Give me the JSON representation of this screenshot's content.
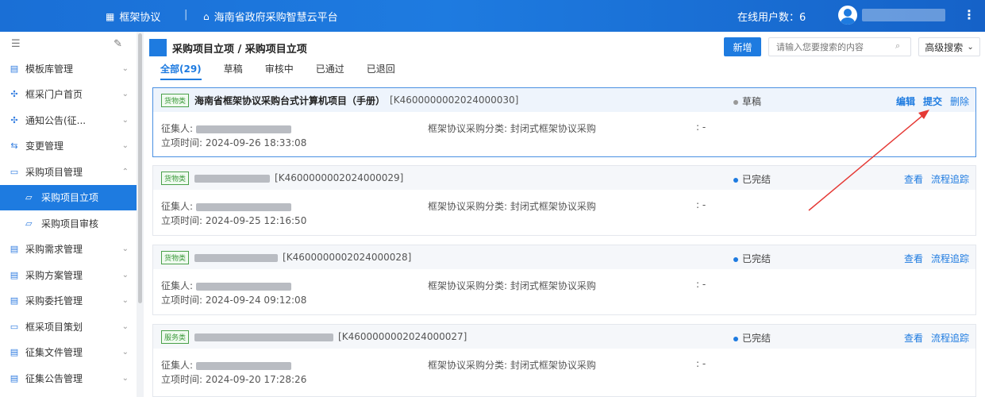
{
  "topbar": {
    "brand": "框架协议",
    "separator": "|",
    "platform": "海南省政府采购智慧云平台",
    "online_label": "在线用户数：",
    "online_count": "6"
  },
  "sidebar": {
    "items": [
      {
        "label": "模板库管理",
        "chevron": "⌄"
      },
      {
        "label": "框采门户首页",
        "chevron": "⌄"
      },
      {
        "label": "通知公告(征...",
        "chevron": "⌄"
      },
      {
        "label": "变更管理",
        "chevron": "⌄"
      },
      {
        "label": "采购项目管理",
        "chevron": "⌃"
      },
      {
        "label": "采购项目立项"
      },
      {
        "label": "采购项目审核"
      },
      {
        "label": "采购需求管理",
        "chevron": "⌄"
      },
      {
        "label": "采购方案管理",
        "chevron": "⌄"
      },
      {
        "label": "采购委托管理",
        "chevron": "⌄"
      },
      {
        "label": "框采项目策划",
        "chevron": "⌄"
      },
      {
        "label": "征集文件管理",
        "chevron": "⌄"
      },
      {
        "label": "征集公告管理",
        "chevron": "⌄"
      }
    ]
  },
  "main": {
    "title": "采购项目立项 / 采购项目立项",
    "new_button": "新增",
    "search_placeholder": "请输入您要搜索的内容",
    "advanced_search": "高级搜索",
    "tabs": [
      "全部(29)",
      "草稿",
      "审核中",
      "已通过",
      "已退回"
    ]
  },
  "cards": [
    {
      "badge": "货物类",
      "project": "海南省框架协议采购台式计算机项目（手册）",
      "code": "[K4600000002024000030]",
      "status": "草稿",
      "status_color": "#999999",
      "actions": [
        "编辑",
        "提交",
        "删除"
      ],
      "collector_label": "征集人:",
      "created_label": "立项时间:",
      "created": "2024-09-26 18:33:08",
      "category_label": "框架协议采购分类:",
      "category": "封闭式框架协议采购",
      "extra": ": -"
    },
    {
      "badge": "货物类",
      "project": "",
      "code": "[K4600000002024000029]",
      "status": "已完结",
      "status_color": "#1e7be0",
      "actions": [
        "查看",
        "流程追踪"
      ],
      "collector_label": "征集人:",
      "created_label": "立项时间:",
      "created": "2024-09-25 12:16:50",
      "category_label": "框架协议采购分类:",
      "category": "封闭式框架协议采购",
      "extra": ": -"
    },
    {
      "badge": "货物类",
      "project": "",
      "code": "[K4600000002024000028]",
      "status": "已完结",
      "status_color": "#1e7be0",
      "actions": [
        "查看",
        "流程追踪"
      ],
      "collector_label": "征集人:",
      "created_label": "立项时间:",
      "created": "2024-09-24 09:12:08",
      "category_label": "框架协议采购分类:",
      "category": "封闭式框架协议采购",
      "extra": ": -"
    },
    {
      "badge": "服务类",
      "project": "",
      "code": "[K4600000002024000027]",
      "status": "已完结",
      "status_color": "#1e7be0",
      "actions": [
        "查看",
        "流程追踪"
      ],
      "collector_label": "征集人:",
      "created_label": "立项时间:",
      "created": "2024-09-20 17:28:26",
      "category_label": "框架协议采购分类:",
      "category": "封闭式框架协议采购",
      "extra": ": -"
    }
  ]
}
